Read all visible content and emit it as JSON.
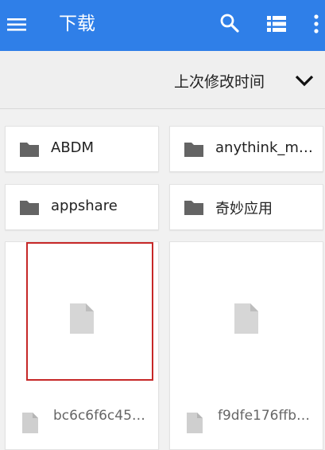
{
  "appbar": {
    "title": "下载",
    "menu_icon": "menu-icon",
    "search_icon": "search-icon",
    "view_icon": "list-view-icon",
    "more_icon": "more-vert-icon",
    "color": "#2f7fe8"
  },
  "sort": {
    "label": "上次修改时间",
    "icon": "chevron-down-icon"
  },
  "folders": [
    {
      "name": "ABDM"
    },
    {
      "name": "anythink_m…"
    },
    {
      "name": "appshare"
    },
    {
      "name": "奇妙应用"
    }
  ],
  "files": [
    {
      "name": "bc6c6f6c45…",
      "selected": true
    },
    {
      "name": "f9dfe176ffb…",
      "selected": false
    }
  ],
  "selection_color": "#c62828"
}
